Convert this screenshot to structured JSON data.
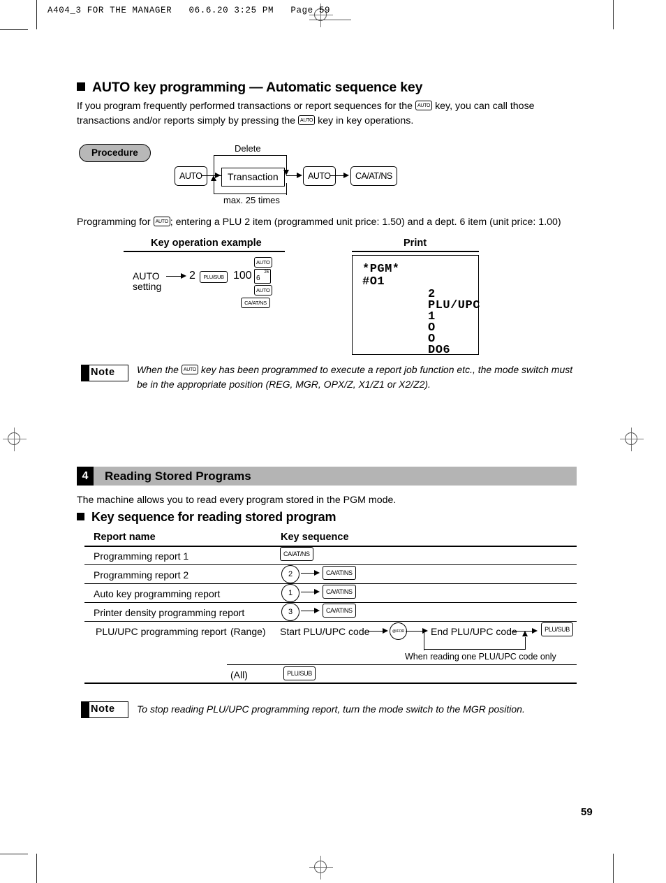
{
  "print_header": {
    "text": "A404_3 FOR THE MANAGER   06.6.20 3:25 PM   Page 59"
  },
  "section_auto": {
    "title": "AUTO key programming — Automatic sequence key",
    "intro_part1": "If you program frequently performed transactions or report sequences for the",
    "intro_key1": "AUTO",
    "intro_part2": "key, you can call those",
    "intro_line2_part1": "transactions and/or reports simply by pressing the",
    "intro_key2": "AUTO",
    "intro_line2_part2": "key in key operations.",
    "procedure_label": "Procedure",
    "flow": {
      "key_auto_start": "AUTO",
      "transaction_box": "Transaction",
      "delete_label": "Delete",
      "max_label": "max. 25 times",
      "key_auto_end": "AUTO",
      "key_caatns": "CA/AT/NS"
    },
    "example_sentence_part1": "Programming for",
    "example_sentence_key": "AUTO",
    "example_sentence_part2": "; entering a PLU 2 item (programmed unit price: 1.50) and a dept. 6 item (unit price: 1.00)",
    "col_head_keyop": "Key operation example",
    "col_head_print": "Print",
    "keyop": {
      "label_line1": "AUTO",
      "label_line2": "setting",
      "num_2": "2",
      "key_plusub": "PLU/SUB",
      "num_100": "100",
      "key_dept_main": "6",
      "key_dept_sup": "26",
      "key_auto_top": "AUTO",
      "key_auto_bottom": "AUTO",
      "key_caatns": "CA/AT/NS"
    },
    "receipt": {
      "line_pgm": "*PGM*",
      "line_no": "#O1",
      "right_lines": [
        "2",
        "PLU/UPC",
        "1",
        "O",
        "O",
        "DO6"
      ]
    },
    "note": {
      "badge": "Note",
      "text_part1": "When the",
      "key": "AUTO",
      "text_part2": "key has been programmed to execute a report job function etc., the mode switch",
      "text_line2": "must be in the appropriate position (REG, MGR, OPX/Z, X1/Z1 or X2/Z2)."
    }
  },
  "section_reading": {
    "number": "4",
    "title": "Reading Stored Programs",
    "intro": "The machine allows you to read every program stored in the PGM mode.",
    "subtitle": "Key sequence for reading stored program",
    "table": {
      "col_report_name": "Report name",
      "col_key_sequence": "Key sequence",
      "rows": [
        {
          "name": "Programming report 1",
          "keys": [
            "CA/AT/NS"
          ]
        },
        {
          "name": "Programming report 2",
          "num": "2",
          "keys": [
            "CA/AT/NS"
          ]
        },
        {
          "name": "Auto key programming report",
          "num": "1",
          "keys": [
            "CA/AT/NS"
          ]
        },
        {
          "name": "Printer density programming report",
          "num": "3",
          "keys": [
            "CA/AT/NS"
          ]
        }
      ],
      "plu_row": {
        "name": "PLU/UPC programming report",
        "range_label": "(Range)",
        "start_label": "Start PLU/UPC code",
        "key_forat": "@/FOR",
        "end_label": "End PLU/UPC code",
        "key_plusub": "PLU/SUB",
        "loop_note": "When reading one PLU/UPC code only",
        "all_label": "(All)",
        "all_key_plusub": "PLU/SUB"
      }
    },
    "note": {
      "badge": "Note",
      "text": "To stop reading PLU/UPC programming report, turn the mode switch to the MGR position."
    }
  },
  "footer": {
    "page_number": "59"
  }
}
